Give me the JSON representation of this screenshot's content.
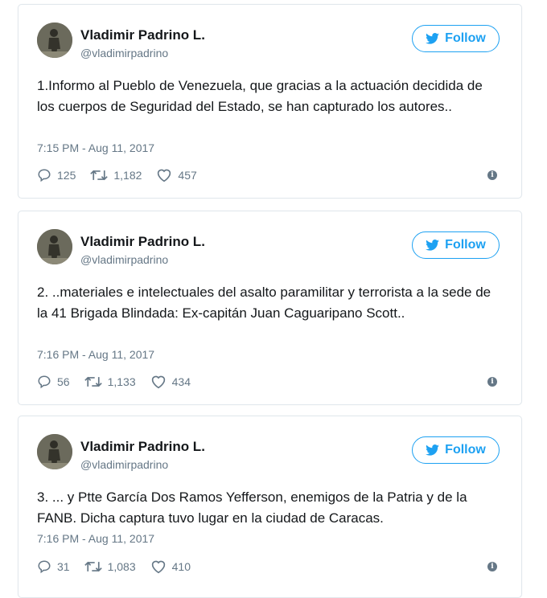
{
  "tweets": [
    {
      "name": "Vladimir Padrino L.",
      "handle": "@vladimirpadrino",
      "follow_label": "Follow",
      "text": "1.Informo al Pueblo de Venezuela, que gracias a la actuación decidida de los cuerpos de Seguridad del Estado, se han capturado los autores..",
      "timestamp": "7:15 PM - Aug 11, 2017",
      "replies": "125",
      "retweets": "1,182",
      "likes": "457"
    },
    {
      "name": "Vladimir Padrino L.",
      "handle": "@vladimirpadrino",
      "follow_label": "Follow",
      "text": "2. ..materiales e intelectuales del asalto paramilitar y terrorista a la sede de la 41 Brigada Blindada: Ex-capitán Juan Caguaripano Scott..",
      "timestamp": "7:16 PM - Aug 11, 2017",
      "replies": "56",
      "retweets": "1,133",
      "likes": "434"
    },
    {
      "name": "Vladimir Padrino L.",
      "handle": "@vladimirpadrino",
      "follow_label": "Follow",
      "text": "3. ... y Ptte García Dos Ramos Yefferson, enemigos de la Patria y de la FANB. Dicha captura tuvo lugar en la ciudad de Caracas.",
      "timestamp": "7:16 PM - Aug 11, 2017",
      "replies": "31",
      "retweets": "1,083",
      "likes": "410"
    }
  ],
  "colors": {
    "accent": "#1da1f2",
    "muted": "#657786",
    "text": "#14171a",
    "border": "#e1e8ed"
  },
  "icons": [
    "avatar-photo",
    "twitter-bird-icon",
    "reply-icon",
    "retweet-icon",
    "like-icon",
    "info-icon"
  ]
}
